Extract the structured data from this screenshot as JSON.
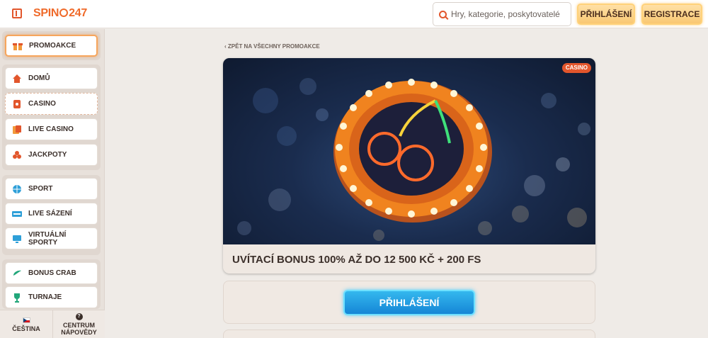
{
  "header": {
    "logo_text_left": "SPIN",
    "logo_text_right": "247",
    "search_placeholder": "Hry, kategorie, poskytovatelé",
    "login_label": "PŘIHLÁŠENÍ",
    "register_label": "REGISTRACE"
  },
  "sidebar": {
    "promo": "PROMOAKCE",
    "items": [
      {
        "label": "DOMŮ",
        "icon": "home-icon"
      },
      {
        "label": "CASINO",
        "icon": "casino-icon"
      },
      {
        "label": "LIVE CASINO",
        "icon": "live-casino-icon"
      },
      {
        "label": "JACKPOTY",
        "icon": "jackpot-icon"
      },
      {
        "label": "SPORT",
        "icon": "sport-ball-icon"
      },
      {
        "label": "LIVE SÁZENÍ",
        "icon": "live-betting-icon"
      },
      {
        "label": "VIRTUÁLNÍ SPORTY",
        "icon": "virtual-sports-icon"
      },
      {
        "label": "BONUS CRAB",
        "icon": "bonus-crab-icon"
      },
      {
        "label": "TURNAJE",
        "icon": "trophy-icon"
      }
    ],
    "language": "ČEŠTINA",
    "help_line1": "CENTRUM",
    "help_line2": "NÁPOVĚDY",
    "help_icon_glyph": "?"
  },
  "main": {
    "back_link": "‹ ZPĚT NA VŠECHNY PROMOAKCE",
    "badge": "CASINO",
    "promo_title": "UVÍTACÍ BONUS 100% AŽ DO 12 500 KČ + 200 FS",
    "login_button": "PŘIHLÁŠENÍ"
  },
  "colors": {
    "accent": "#e2562c",
    "login_button": "#1586d6",
    "header_button": "#f9c873"
  }
}
